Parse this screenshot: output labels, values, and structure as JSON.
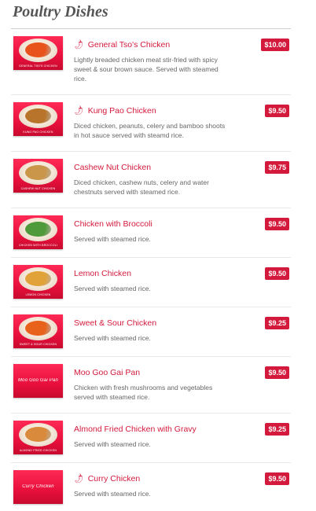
{
  "section": {
    "title": "Poultry Dishes"
  },
  "colors": {
    "accent": "#d41a3c",
    "text_muted": "#666666",
    "title": "#555555"
  },
  "items": [
    {
      "name": "General Tso's Chicken",
      "spicy": true,
      "spicy_icon": "chili-pepper-icon",
      "description": "Lightly breaded chicken meat stir-fried with spicy sweet & sour brown sauce. Served with steamed rice.",
      "price": "$10.00",
      "image_caption": "GENERAL TSO'S CHICKEN",
      "food_color": "#e8531c"
    },
    {
      "name": "Kung Pao Chicken",
      "spicy": true,
      "spicy_icon": "chili-pepper-icon",
      "description": "Diced chicken, peanuts, celery and bamboo shoots in hot sauce served with steamd rice.",
      "price": "$9.50",
      "image_caption": "KUNG PAO CHICKEN",
      "food_color": "#b8742a"
    },
    {
      "name": "Cashew Nut Chicken",
      "spicy": false,
      "description": "Diced chicken, cashew nuts, celery and water chestnuts served with steamed rice.",
      "price": "$9.75",
      "image_caption": "CASHEW NUT CHICKEN",
      "food_color": "#c9964a"
    },
    {
      "name": "Chicken with Broccoli",
      "spicy": false,
      "description": "Served with steamed rice.",
      "price": "$9.50",
      "image_caption": "CHICKEN WITH BROCCOLI",
      "food_color": "#4f9a3a"
    },
    {
      "name": "Lemon Chicken",
      "spicy": false,
      "description": "Served with steamed rice.",
      "price": "$9.50",
      "image_caption": "LEMON CHICKEN",
      "food_color": "#e2a23a"
    },
    {
      "name": "Sweet & Sour Chicken",
      "spicy": false,
      "description": "Served with steamed rice.",
      "price": "$9.25",
      "image_caption": "SWEET & SOUR CHICKEN",
      "food_color": "#e8621c"
    },
    {
      "name": "Moo Goo Gai Pan",
      "spicy": false,
      "description": "Chicken with fresh mushrooms and vegetables served with steamed rice.",
      "price": "$9.50",
      "image_caption": "Moo Goo Gai Pan",
      "food_color": ""
    },
    {
      "name": "Almond Fried Chicken with Gravy",
      "spicy": false,
      "description": "Served with steamed rice.",
      "price": "$9.25",
      "image_caption": "ALMOND FRIED CHICKEN",
      "food_color": "#d98a3a"
    },
    {
      "name": "Curry Chicken",
      "spicy": true,
      "spicy_icon": "chili-pepper-icon",
      "description": "Served with steamed rice.",
      "price": "$9.50",
      "image_caption": "Curry Chicken",
      "food_color": ""
    }
  ]
}
